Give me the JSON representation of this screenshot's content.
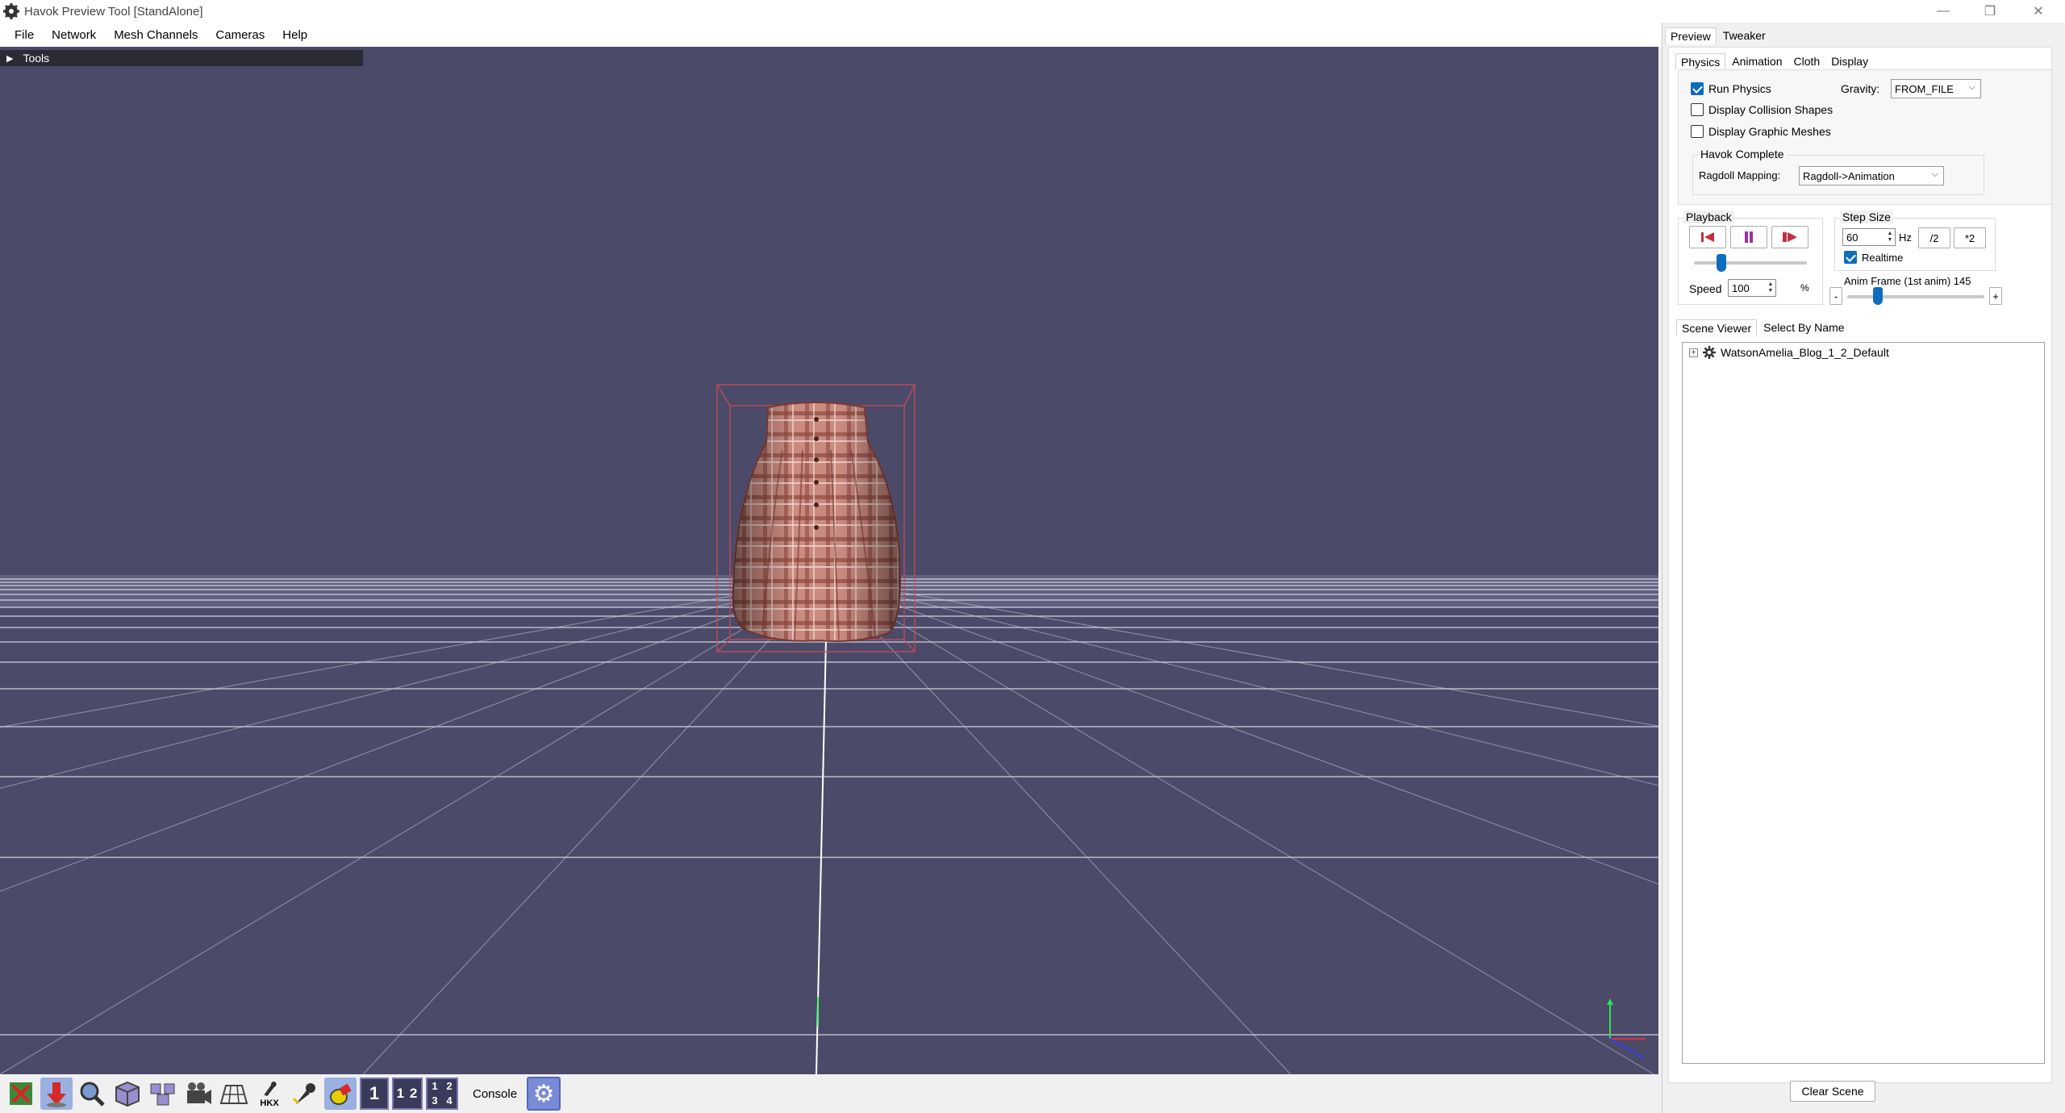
{
  "window": {
    "title": "Havok Preview Tool [StandAlone]",
    "minimize": "—",
    "restore": "❐",
    "close": "✕"
  },
  "menu": [
    "File",
    "Network",
    "Mesh Channels",
    "Cameras",
    "Help"
  ],
  "viewport": {
    "tools_label": "Tools",
    "background_color": "#4b4a69"
  },
  "toolbar": {
    "buttons": [
      "physics-toggle-icon",
      "gravity-arrow-icon",
      "magnifier-icon",
      "cube-icon",
      "multi-cube-icon",
      "camera-icon",
      "grid-icon",
      "hkx-icon",
      "pin-icon",
      "pin2-icon",
      "light-icon"
    ],
    "hkx_label": "HKX",
    "view_single": "1",
    "view_double": "1 2",
    "view_quad": [
      "1",
      "2",
      "3",
      "4"
    ],
    "console_label": "Console"
  },
  "right_panel": {
    "top_tabs": [
      "Preview",
      "Tweaker"
    ],
    "sub_tabs": [
      "Physics",
      "Animation",
      "Cloth",
      "Display"
    ],
    "run_physics": "Run Physics",
    "display_collision": "Display Collision Shapes",
    "display_graphic": "Display Graphic Meshes",
    "gravity_label": "Gravity:",
    "gravity_value": "FROM_FILE",
    "havok_complete": "Havok Complete",
    "ragdoll_label": "Ragdoll Mapping:",
    "ragdoll_value": "Ragdoll->Animation",
    "playback_title": "Playback",
    "speed_label": "Speed",
    "speed_value": "100",
    "speed_unit": "%",
    "step_size_title": "Step Size",
    "step_value": "60",
    "hz_label": "Hz",
    "half_button": "/2",
    "double_button": "*2",
    "realtime_label": "Realtime",
    "anim_frame_label": "Anim Frame (1st anim) 145",
    "minus_button": "-",
    "plus_button": "+",
    "scene_tabs": [
      "Scene Viewer",
      "Select By Name"
    ],
    "scene_root": "WatsonAmelia_Blog_1_2_Default",
    "clear_scene": "Clear Scene"
  }
}
